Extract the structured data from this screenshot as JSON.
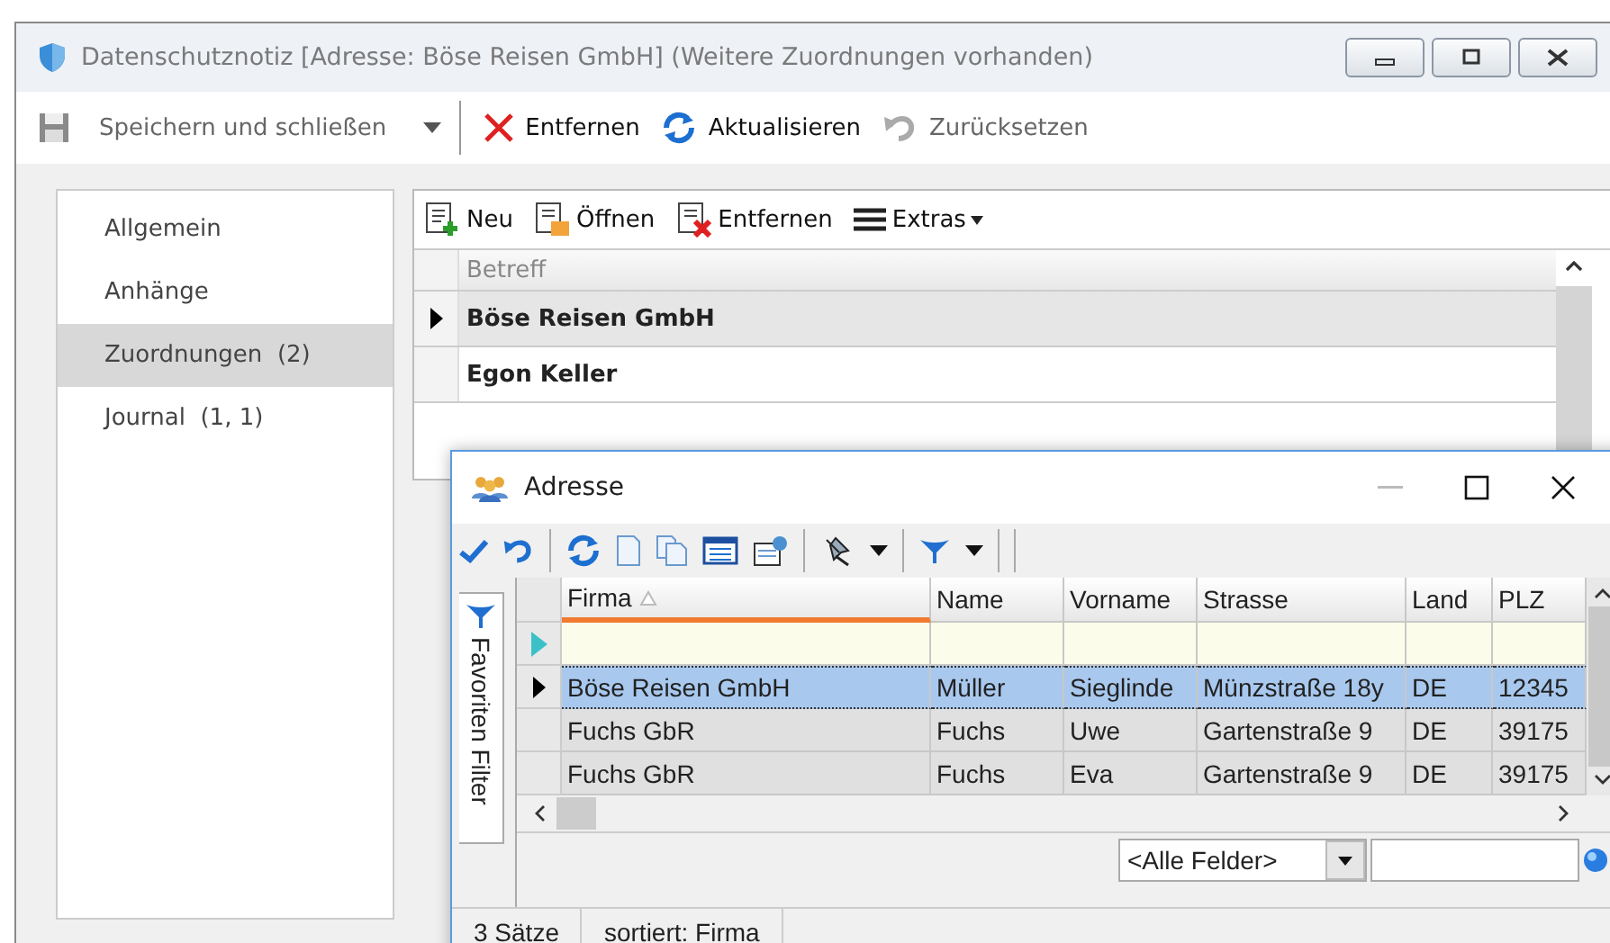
{
  "window": {
    "title": "Datenschutznotiz [Adresse: Böse Reisen GmbH] (Weitere Zuordnungen vorhanden)"
  },
  "toolbar": [
    {
      "kind": "save",
      "label": "Speichern und schließen",
      "disabled": true,
      "dropdown": true
    },
    {
      "kind": "delete",
      "label": "Entfernen",
      "disabled": false,
      "dropdown": false
    },
    {
      "kind": "refresh",
      "label": "Aktualisieren",
      "disabled": false,
      "dropdown": false
    },
    {
      "kind": "undo",
      "label": "Zurücksetzen",
      "disabled": true,
      "dropdown": false
    }
  ],
  "sidebar": {
    "items": [
      {
        "label": "Allgemein",
        "selected": false
      },
      {
        "label": "Anhänge",
        "selected": false
      },
      {
        "label": "Zuordnungen  (2)",
        "selected": true
      },
      {
        "label": "Journal  (1, 1)",
        "selected": false
      }
    ]
  },
  "panel": {
    "toolbar": [
      {
        "kind": "new",
        "label": "Neu"
      },
      {
        "kind": "open",
        "label": "Öffnen"
      },
      {
        "kind": "remove",
        "label": "Entfernen"
      },
      {
        "kind": "menu",
        "label": "Extras",
        "dropdown": true
      }
    ],
    "table": {
      "columns": [
        "Betreff"
      ],
      "rows": [
        {
          "cells": [
            "Böse Reisen GmbH"
          ],
          "selected": true
        },
        {
          "cells": [
            "Egon Keller"
          ],
          "selected": false
        }
      ]
    }
  },
  "dialog": {
    "title": "Adresse",
    "side_tab": "Favoriten Filter",
    "table": {
      "columns": [
        {
          "label": "Firma",
          "sorted": true
        },
        {
          "label": "Name",
          "sorted": false
        },
        {
          "label": "Vorname",
          "sorted": false
        },
        {
          "label": "Strasse",
          "sorted": false
        },
        {
          "label": "Land",
          "sorted": false
        },
        {
          "label": "PLZ",
          "sorted": false
        }
      ],
      "rows": [
        {
          "cells": [
            "Böse Reisen GmbH",
            "Müller",
            "Sieglinde",
            "Münzstraße 18y",
            "DE",
            "12345"
          ],
          "selected": true
        },
        {
          "cells": [
            "Fuchs GbR",
            "Fuchs",
            "Uwe",
            "Gartenstraße  9",
            "DE",
            "39175"
          ],
          "selected": false
        },
        {
          "cells": [
            "Fuchs GbR",
            "Fuchs",
            "Eva",
            "Gartenstraße  9",
            "DE",
            "39175"
          ],
          "selected": false
        }
      ]
    },
    "filter_field": {
      "value": "<Alle Felder>"
    },
    "status_bar": [
      "3 Sätze",
      "sortiert: Firma"
    ]
  }
}
